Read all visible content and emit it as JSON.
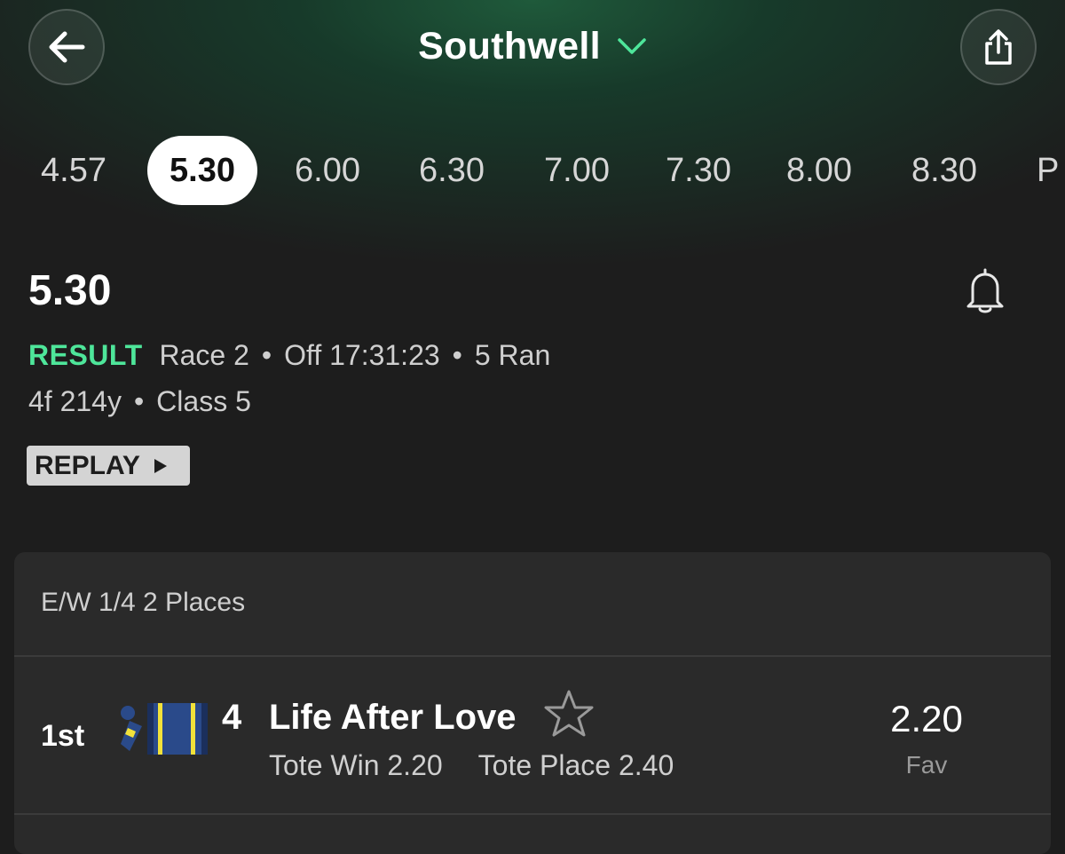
{
  "header": {
    "title": "Southwell",
    "back_icon": "arrow-left-icon",
    "share_icon": "share-icon",
    "dropdown_icon": "chevron-down-icon"
  },
  "tabs": [
    {
      "label": "4.57",
      "active": false
    },
    {
      "label": "5.30",
      "active": true
    },
    {
      "label": "6.00",
      "active": false
    },
    {
      "label": "6.30",
      "active": false
    },
    {
      "label": "7.00",
      "active": false
    },
    {
      "label": "7.30",
      "active": false
    },
    {
      "label": "8.00",
      "active": false
    },
    {
      "label": "8.30",
      "active": false
    },
    {
      "label": "P",
      "active": false
    }
  ],
  "race": {
    "time": "5.30",
    "status": "RESULT",
    "race_number": "Race 2",
    "off_time": "Off 17:31:23",
    "runners": "5 Ran",
    "distance": "4f 214y",
    "race_class": "Class 5",
    "replay_label": "REPLAY"
  },
  "results": {
    "each_way": "E/W 1/4 2 Places",
    "rows": [
      {
        "position": "1st",
        "number": "4",
        "horse": "Life After Love",
        "tote_win": "Tote Win 2.20",
        "tote_place": "Tote Place 2.40",
        "odds": "2.20",
        "odds_note": "Fav"
      }
    ]
  },
  "colors": {
    "accent_green": "#4ee69a",
    "background": "#1d1d1d",
    "card": "#2a2a2a",
    "silks_blue": "#2a4a8a",
    "silks_yellow": "#f2e23a"
  }
}
